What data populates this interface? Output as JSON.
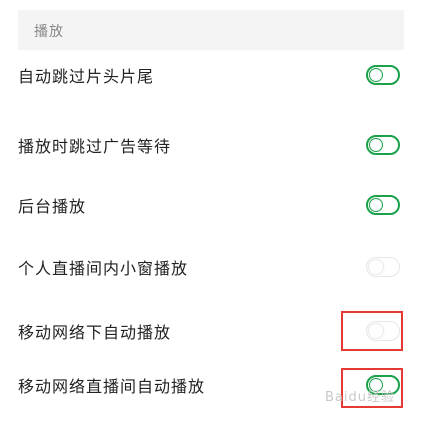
{
  "header": {
    "title": "播放"
  },
  "settings": [
    {
      "label": "自动跳过片头片尾",
      "state": "on"
    },
    {
      "label": "播放时跳过广告等待",
      "state": "on"
    },
    {
      "label": "后台播放",
      "state": "on"
    },
    {
      "label": "个人直播间内小窗播放",
      "state": "off"
    },
    {
      "label": "移动网络下自动播放",
      "state": "off"
    },
    {
      "label": "移动网络直播间自动播放",
      "state": "on"
    }
  ],
  "colors": {
    "accent": "#1aa14a",
    "highlight": "#e53935"
  },
  "watermark": "Baidu经验"
}
